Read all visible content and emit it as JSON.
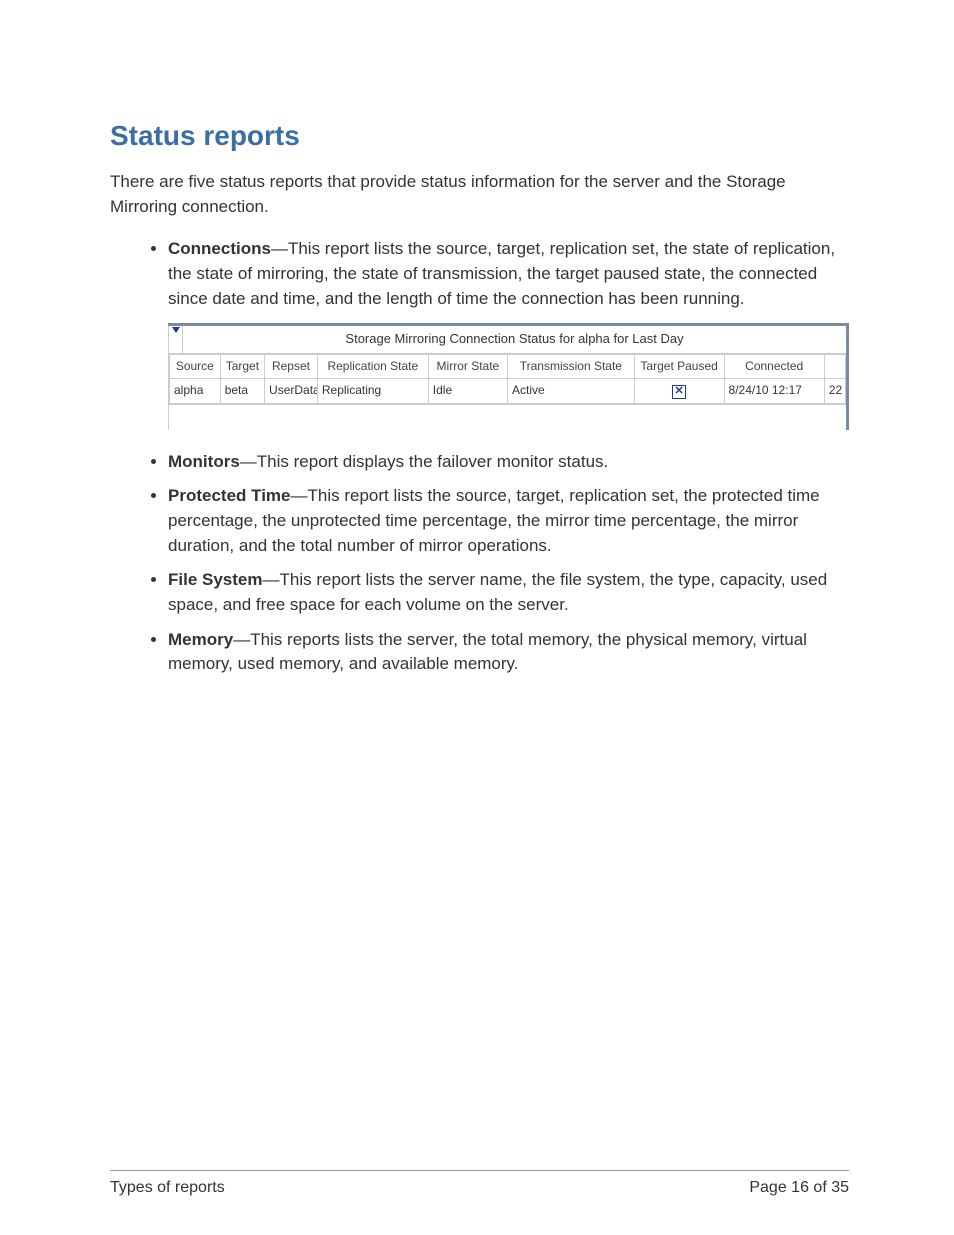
{
  "heading": "Status reports",
  "intro": "There are five status reports that provide status information for the server and the Storage Mirroring connection.",
  "items": [
    {
      "term": "Connections",
      "desc": "—This report lists the source, target, replication set, the state of replication, the state of mirroring, the state of transmission, the target paused state, the connected since date and time, and the length of time the connection has been running."
    },
    {
      "term": "Monitors",
      "desc": "—This report displays the failover monitor status."
    },
    {
      "term": "Protected Time",
      "desc": "—This report lists the source, target, replication set, the protected time percentage, the unprotected time percentage, the mirror time percentage, the mirror duration, and the total number of mirror operations."
    },
    {
      "term": "File System",
      "desc": "—This report lists the server name, the file system, the type, capacity, used space, and free space for each volume on the server."
    },
    {
      "term": "Memory",
      "desc": "—This reports lists the server, the total memory, the physical memory, virtual memory, used memory, and available memory."
    }
  ],
  "table": {
    "title": "Storage Mirroring Connection Status for alpha for Last Day",
    "headers": {
      "source": "Source",
      "target": "Target",
      "repset": "Repset",
      "replication": "Replication State",
      "mirror": "Mirror State",
      "transmission": "Transmission State",
      "paused": "Target Paused",
      "connected": "Connected",
      "last": ""
    },
    "row": {
      "source": "alpha",
      "target": "beta",
      "repset": "UserData",
      "replication": "Replicating",
      "mirror": "Idle",
      "transmission": "Active",
      "paused_icon": "x",
      "connected": "8/24/10 12:17",
      "last": "22"
    }
  },
  "footer": {
    "left": "Types of reports",
    "right": "Page 16 of 35"
  }
}
